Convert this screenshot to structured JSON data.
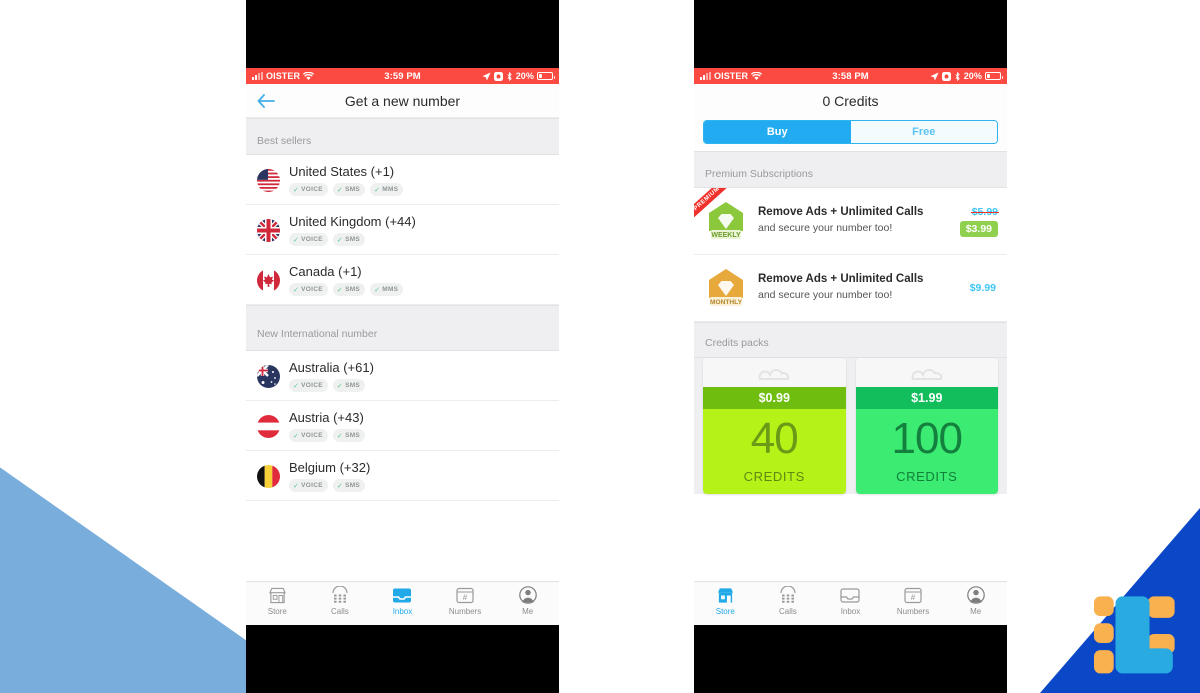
{
  "brand": {
    "logo_name": "logo-mark",
    "colors": {
      "blue": "#0B48C8",
      "light_blue": "#79ADDC",
      "cyan": "#29ABE2",
      "orange": "#F9B04E"
    }
  },
  "phone_left": {
    "status_bar": {
      "carrier": "OISTER",
      "time": "3:59 PM",
      "battery_percent": "20%",
      "icons": [
        "signal-bars-icon",
        "wifi-icon",
        "location-arrow-icon",
        "rotation-lock-icon",
        "bluetooth-icon",
        "battery-icon"
      ]
    },
    "navbar": {
      "back_icon": "back-arrow-icon",
      "title": "Get a new number"
    },
    "sections": [
      {
        "header": "Best sellers",
        "items": [
          {
            "name": "United States (+1)",
            "flag": "flag-us",
            "tags": [
              "VOICE",
              "SMS",
              "MMS"
            ]
          },
          {
            "name": "United Kingdom (+44)",
            "flag": "flag-uk",
            "tags": [
              "VOICE",
              "SMS"
            ]
          },
          {
            "name": "Canada (+1)",
            "flag": "flag-ca",
            "tags": [
              "VOICE",
              "SMS",
              "MMS"
            ]
          }
        ]
      },
      {
        "header": "New International number",
        "items": [
          {
            "name": "Australia (+61)",
            "flag": "flag-au",
            "tags": [
              "VOICE",
              "SMS"
            ]
          },
          {
            "name": "Austria (+43)",
            "flag": "flag-at",
            "tags": [
              "VOICE",
              "SMS"
            ]
          },
          {
            "name": "Belgium (+32)",
            "flag": "flag-be",
            "tags": [
              "VOICE",
              "SMS"
            ]
          }
        ]
      }
    ],
    "tabbar": {
      "active": "Inbox",
      "tabs": [
        {
          "label": "Store",
          "icon": "store-icon"
        },
        {
          "label": "Calls",
          "icon": "keypad-icon"
        },
        {
          "label": "Inbox",
          "icon": "inbox-tray-icon"
        },
        {
          "label": "Numbers",
          "icon": "hash-card-icon"
        },
        {
          "label": "Me",
          "icon": "person-icon"
        }
      ]
    }
  },
  "phone_right": {
    "status_bar": {
      "carrier": "OISTER",
      "time": "3:58 PM",
      "battery_percent": "20%",
      "icons": [
        "signal-bars-icon",
        "wifi-icon",
        "location-arrow-icon",
        "rotation-lock-icon",
        "bluetooth-icon",
        "battery-icon"
      ]
    },
    "navbar": {
      "title": "0 Credits"
    },
    "segmented": {
      "buy": "Buy",
      "free": "Free",
      "selected": "Buy"
    },
    "premium": {
      "header": "Premium Subscriptions",
      "items": [
        {
          "ribbon": "PREMIUM",
          "period": "WEEKLY",
          "title": "Remove Ads + Unlimited Calls",
          "subtitle": "and secure your number too!",
          "price_old": "$5.99",
          "price_new": "$3.99",
          "badge_color": "#8CC83C"
        },
        {
          "ribbon": "",
          "period": "MONTHLY",
          "title": "Remove Ads + Unlimited Calls",
          "subtitle": "and secure your number too!",
          "price_old": "",
          "price_new": "$9.99",
          "badge_color": "#E8A93C"
        }
      ]
    },
    "credits": {
      "header": "Credits packs",
      "packs": [
        {
          "price": "$0.99",
          "amount": "40",
          "unit": "CREDITS",
          "header_color": "#6FBE0F",
          "body_color": "#B4F218",
          "num_color": "#6B9A16"
        },
        {
          "price": "$1.99",
          "amount": "100",
          "unit": "CREDITS",
          "header_color": "#12BE5B",
          "body_color": "#3BEB72",
          "num_color": "#14803D"
        }
      ]
    },
    "tabbar": {
      "active": "Store",
      "tabs": [
        {
          "label": "Store",
          "icon": "store-icon"
        },
        {
          "label": "Calls",
          "icon": "keypad-icon"
        },
        {
          "label": "Inbox",
          "icon": "inbox-tray-icon"
        },
        {
          "label": "Numbers",
          "icon": "hash-card-icon"
        },
        {
          "label": "Me",
          "icon": "person-icon"
        }
      ]
    }
  }
}
